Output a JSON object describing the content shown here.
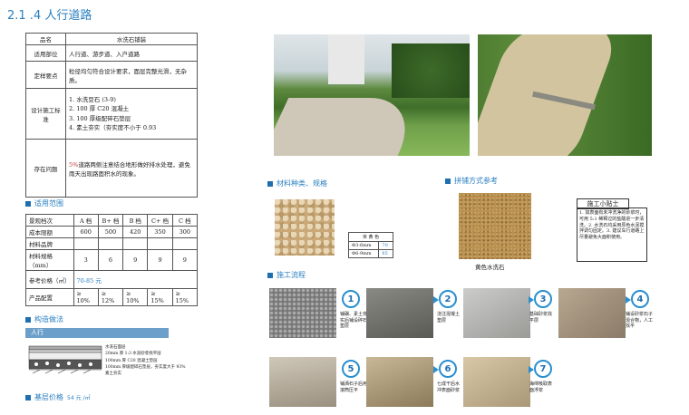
{
  "page_title": "2.1 .4 人行道路",
  "spec_table": {
    "header_label": "品名",
    "header_value": "水洗石铺装",
    "rows": [
      {
        "label": "适用部位",
        "value": "人行道、游步道、入户道路"
      },
      {
        "label": "定样要点",
        "value": "粒径均匀符合设计要求，面层完整光滑，无杂质。"
      },
      {
        "label": "设计施工标准",
        "lines": [
          "1. 水洗豆石 (3-9)",
          "2. 100 厚 C20 混凝土",
          "3. 100 厚级配碎石垫层",
          "4. 素土夯实（夯实度不小于 0.93"
        ]
      },
      {
        "label": "存在问题",
        "mark": "5%",
        "value": "道路两侧注意结合地形做好排水处理，避免雨天出现路面积水的现象。"
      }
    ]
  },
  "scope": {
    "title": "适用范围",
    "cols": [
      "景观档次",
      "A 档",
      "B+ 档",
      "B 档",
      "C+ 档",
      "C 档"
    ],
    "rows": [
      [
        "成本限额",
        "600",
        "500",
        "420",
        "350",
        "300"
      ],
      [
        "材料品牌",
        "",
        "",
        "",
        "",
        ""
      ],
      [
        "材料规格（mm）",
        "3",
        "6",
        "9",
        "9",
        "9"
      ],
      [
        "参考价格（㎡）",
        "70-85 元"
      ],
      [
        "产品配置",
        "≥ 10%",
        "≥ 12%",
        "≥ 10%",
        "≥ 15%",
        "≥ 15%"
      ]
    ]
  },
  "construction": {
    "title": "构造做法",
    "bar_label": "人行",
    "layers": [
      "水洗石面层",
      "20mm 厚 1:3 水泥砂浆找平层",
      "100mm 厚 C20 混凝土垫层",
      "100mm 厚级配碎石垫层，夯实度大于 93%",
      "素土夯实"
    ]
  },
  "base_price": {
    "label": "基层价格",
    "value": "54 元 /㎡"
  },
  "materials": {
    "title": "材料种类、规格",
    "table_title": "米 黄 色",
    "rows": [
      [
        "Φ3-6mm",
        "70"
      ],
      [
        "Φ6-9mm",
        "85"
      ]
    ]
  },
  "pattern": {
    "title": "拼铺方式参考",
    "caption": "黄色水洗石"
  },
  "tips": {
    "title": "施工小贴士",
    "text": "1. 如表面有未冲洗净的砂浆时，可用 5:1 稀释过的盐酸进一步清洗。2. 水洗石均采用原色水泥搅拌调匀固定。3. 建议车行道路上尽量避免大面积使用。"
  },
  "flow": {
    "title": "施工流程",
    "steps": [
      {
        "n": "1",
        "caption": "铺碾、素土夯实后铺设碎石垫层"
      },
      {
        "n": "2",
        "caption": "浇注混凝土垫层"
      },
      {
        "n": "3",
        "caption": "基础砂浆找平层"
      },
      {
        "n": "4",
        "caption": "铺设砂浆石子混合物，人工找平"
      },
      {
        "n": "5",
        "caption": "铺洒石子后用滚筒压平"
      },
      {
        "n": "6",
        "caption": "七成干后水冲表面砂浆"
      },
      {
        "n": "7",
        "caption": "海绵吸取表面浮浆"
      }
    ]
  },
  "colors": {
    "accent": "#2a7fc0",
    "dark_blue": "#1f6fb0",
    "bar": "#6c9fc9"
  }
}
